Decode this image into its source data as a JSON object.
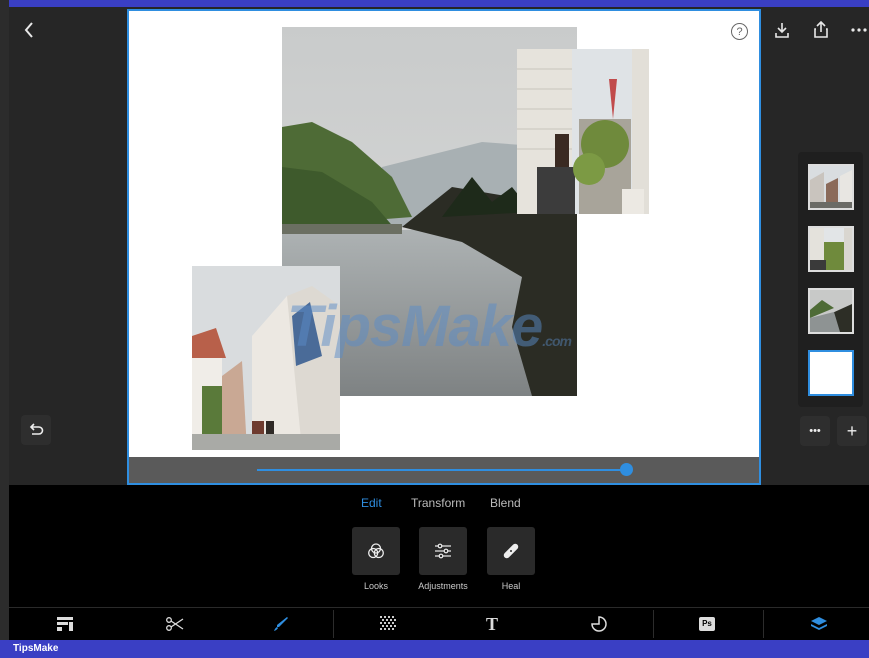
{
  "top_actions": [
    "back-icon",
    "download-icon",
    "share-icon",
    "more-icon"
  ],
  "canvas": {
    "help_symbol": "?",
    "watermark_main": "TipsMake",
    "watermark_suffix": ".com"
  },
  "slider": {
    "value_fraction": 0.98
  },
  "layers": {
    "more_label": "•••",
    "add_label": "+"
  },
  "panel": {
    "tabs": [
      {
        "label": "Edit",
        "active": true
      },
      {
        "label": "Transform",
        "active": false
      },
      {
        "label": "Blend",
        "active": false
      }
    ],
    "tools": [
      {
        "label": "Looks",
        "icon": "looks-icon"
      },
      {
        "label": "Adjustments",
        "icon": "adjustments-icon"
      },
      {
        "label": "Heal",
        "icon": "heal-icon"
      }
    ]
  },
  "bottom_bar": {
    "items": [
      "layout-icon",
      "cut-icon",
      "brush-icon",
      "texture-icon",
      "text-icon",
      "shape-icon",
      "ps-icon",
      "layers-icon"
    ],
    "text_label": "T",
    "ps_label": "Ps",
    "active": "layers-icon",
    "accent": "#2f8ee0"
  },
  "brand": {
    "label": "TipsMake"
  },
  "colors": {
    "accent": "#2f8ee0",
    "frame": "#3a3fc4"
  }
}
